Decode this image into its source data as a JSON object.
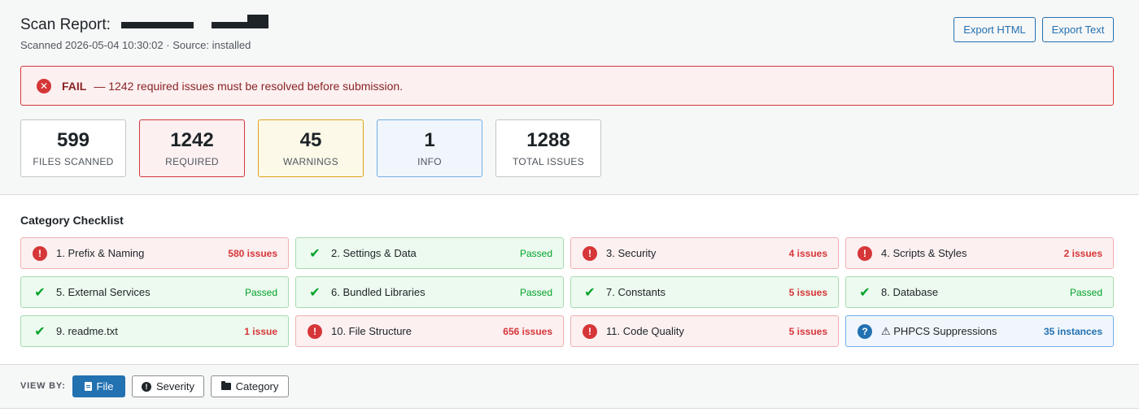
{
  "header": {
    "title": "Scan Report:",
    "subtitle": "Scanned 2026-05-04 10:30:02 · Source: installed",
    "export_html_label": "Export HTML",
    "export_text_label": "Export Text"
  },
  "alert": {
    "status": "FAIL",
    "message": "— 1242 required issues must be resolved before submission.",
    "icon": "error-circle-icon",
    "color": "#d63638"
  },
  "stats": [
    {
      "value": "599",
      "label": "FILES SCANNED"
    },
    {
      "value": "1242",
      "label": "REQUIRED"
    },
    {
      "value": "45",
      "label": "WARNINGS"
    },
    {
      "value": "1",
      "label": "INFO"
    },
    {
      "value": "1288",
      "label": "TOTAL ISSUES"
    }
  ],
  "checklist": {
    "title": "Category Checklist",
    "items": [
      {
        "name": "1. Prefix & Naming",
        "status": "580 issues",
        "state": "fail"
      },
      {
        "name": "2. Settings & Data",
        "status": "Passed",
        "state": "pass"
      },
      {
        "name": "3. Security",
        "status": "4 issues",
        "state": "fail"
      },
      {
        "name": "4. Scripts & Styles",
        "status": "2 issues",
        "state": "fail"
      },
      {
        "name": "5. External Services",
        "status": "Passed",
        "state": "pass"
      },
      {
        "name": "6. Bundled Libraries",
        "status": "Passed",
        "state": "pass"
      },
      {
        "name": "7. Constants",
        "status": "5 issues",
        "state": "fail"
      },
      {
        "name": "8. Database",
        "status": "Passed",
        "state": "pass"
      },
      {
        "name": "9. readme.txt",
        "status": "1 issue",
        "state": "fail"
      },
      {
        "name": "10. File Structure",
        "status": "656 issues",
        "state": "fail"
      },
      {
        "name": "11. Code Quality",
        "status": "5 issues",
        "state": "fail"
      },
      {
        "name": "⚠ PHPCS Suppressions",
        "status": "35 instances",
        "state": "info"
      }
    ]
  },
  "view_by": {
    "label": "VIEW BY:",
    "options": [
      "File",
      "Severity",
      "Category"
    ],
    "selected": "File"
  },
  "colors": {
    "accent": "#2271b1",
    "fail": "#d63638",
    "pass": "#00a32a",
    "warning": "#dba617"
  }
}
